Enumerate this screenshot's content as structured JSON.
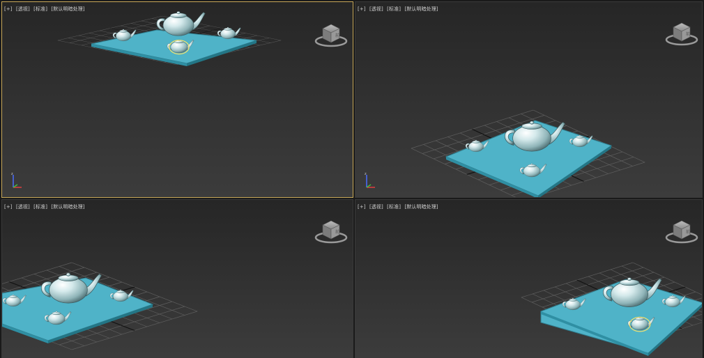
{
  "viewports": [
    {
      "id": "top-left",
      "labels": {
        "plus": "[+]",
        "view": "[透视]",
        "shading": "[标准]",
        "lighting": "[默认明暗处理]"
      },
      "active": true
    },
    {
      "id": "top-right",
      "labels": {
        "plus": "[+]",
        "view": "[透视]",
        "shading": "[标准]",
        "lighting": "[默认明暗处理]"
      },
      "active": false
    },
    {
      "id": "bottom-left",
      "labels": {
        "plus": "[+]",
        "view": "[透视]",
        "shading": "[标准]",
        "lighting": "[默认明暗处理]"
      },
      "active": false
    },
    {
      "id": "bottom-right",
      "labels": {
        "plus": "[+]",
        "view": "[透视]",
        "shading": "[标准]",
        "lighting": "[默认明暗处理]"
      },
      "active": false
    }
  ],
  "colors": {
    "active_border": "#c8a858",
    "plane": "#4fb3c8",
    "teapot": "#c7e0e2",
    "selection": "#f0e070",
    "grid": "#5a5a5a"
  },
  "icons": {
    "viewcube": "viewcube-icon",
    "axis": "axis-tripod-icon"
  }
}
